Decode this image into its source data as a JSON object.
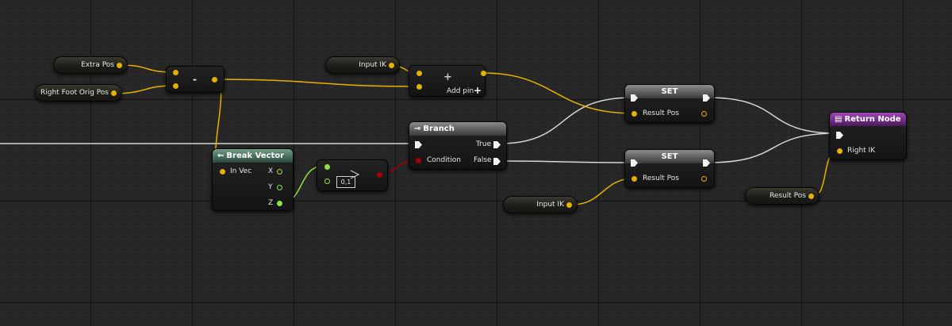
{
  "variables": {
    "extra_pos": "Extra Pos",
    "right_foot_orig_pos": "Right Foot Orig Pos",
    "input_ik_top": "Input IK",
    "input_ik_bottom": "Input IK",
    "result_pos_get": "Result Pos"
  },
  "subtract_node": {
    "title": "-"
  },
  "add_node": {
    "title": "+",
    "add_pin": "Add pin",
    "add_pin_icon": "+"
  },
  "break_vector": {
    "title": "Break Vector",
    "input": "In Vec",
    "outputs": [
      "X",
      "Y",
      "Z"
    ]
  },
  "compare_node": {
    "value": "0,1",
    "icon": "greater-than-icon"
  },
  "branch": {
    "title": "Branch",
    "condition": "Condition",
    "true_label": "True",
    "false_label": "False"
  },
  "set_top": {
    "title": "SET",
    "pin": "Result Pos"
  },
  "set_bottom": {
    "title": "SET",
    "pin": "Result Pos"
  },
  "return_node": {
    "title": "Return Node",
    "pin": "Right IK"
  },
  "colors": {
    "vector_pin": "#e5b100",
    "float_pin": "#8de046",
    "bool_pin": "#a80000",
    "exec_wire": "#d6d6d6",
    "return_header": "#8a3aa0",
    "break_header": "#4c7a64"
  }
}
